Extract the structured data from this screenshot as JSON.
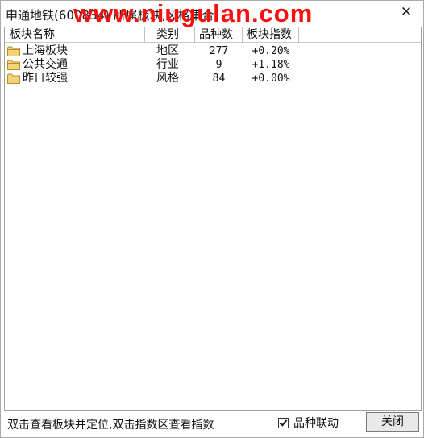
{
  "window": {
    "title": "申通地铁(600834) 所属板块,风格集合",
    "watermark": "www.niugulan.com",
    "close_glyph": "✕"
  },
  "table": {
    "columns": [
      "板块名称",
      "类别",
      "品种数",
      "板块指数"
    ],
    "rows": [
      {
        "name": "上海板块",
        "type": "地区",
        "count": "277",
        "index": "+0.20%",
        "icon": "folder-icon"
      },
      {
        "name": "公共交通",
        "type": "行业",
        "count": "9",
        "index": "+1.18%",
        "icon": "folder-icon"
      },
      {
        "name": "昨日较强",
        "type": "风格",
        "count": "84",
        "index": "+0.00%",
        "icon": "folder-icon"
      }
    ]
  },
  "footer": {
    "hint": "双击查看板块并定位,双击指数区查看指数",
    "linkage_label": "品种联动",
    "linkage_checked": true,
    "close_label": "关闭"
  },
  "colors": {
    "watermark": "#ff0d0d",
    "folder_fill": "#f2d37a",
    "folder_stroke": "#b8912a"
  }
}
